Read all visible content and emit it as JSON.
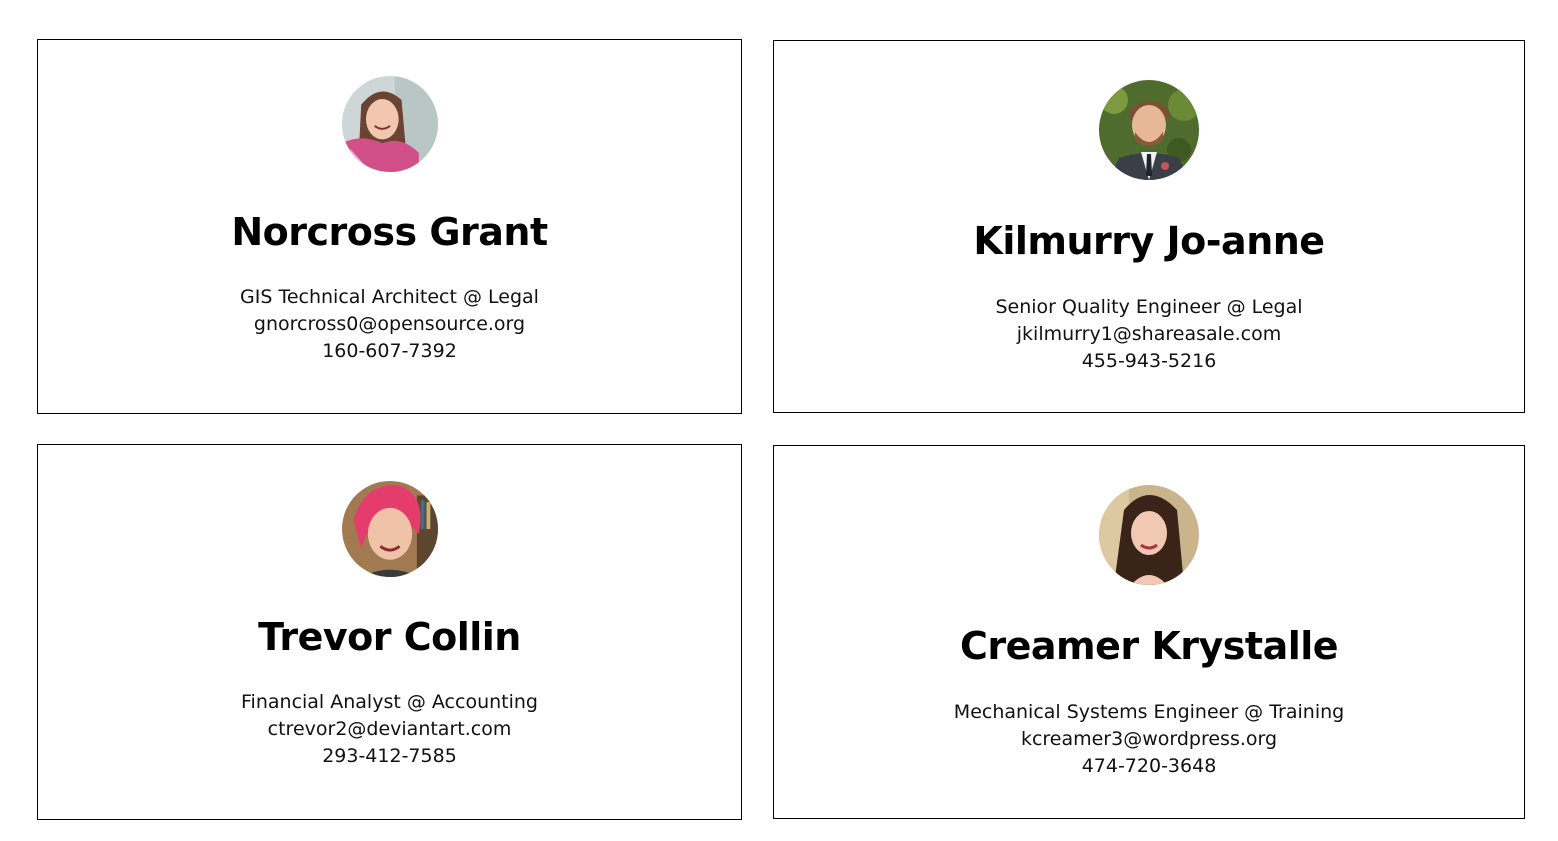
{
  "cards": [
    {
      "name": "Norcross Grant",
      "job": "GIS Technical Architect @ Legal",
      "email": "gnorcross0@opensource.org",
      "phone": "160-607-7392",
      "avatar_icon": "avatar-photo"
    },
    {
      "name": "Kilmurry Jo-anne",
      "job": "Senior Quality Engineer @ Legal",
      "email": "jkilmurry1@shareasale.com",
      "phone": "455-943-5216",
      "avatar_icon": "avatar-photo"
    },
    {
      "name": "Trevor Collin",
      "job": "Financial Analyst @ Accounting",
      "email": "ctrevor2@deviantart.com",
      "phone": "293-412-7585",
      "avatar_icon": "avatar-photo"
    },
    {
      "name": "Creamer Krystalle",
      "job": "Mechanical Systems Engineer @ Training",
      "email": "kcreamer3@wordpress.org",
      "phone": "474-720-3648",
      "avatar_icon": "avatar-photo"
    }
  ],
  "colors": {
    "border": "#000000",
    "background": "#ffffff",
    "text": "#000000"
  }
}
